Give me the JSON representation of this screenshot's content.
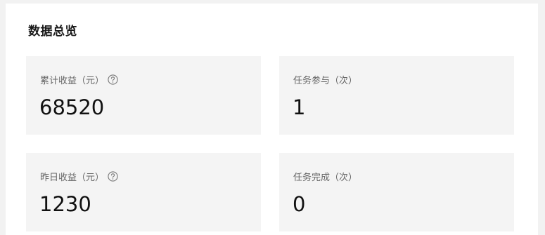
{
  "overview": {
    "title": "数据总览",
    "cards": [
      {
        "label": "累计收益（元）",
        "value": "68520",
        "has_help": true
      },
      {
        "label": "任务参与（次）",
        "value": "1",
        "has_help": false
      },
      {
        "label": "昨日收益（元）",
        "value": "1230",
        "has_help": true
      },
      {
        "label": "任务完成（次）",
        "value": "0",
        "has_help": false
      }
    ]
  },
  "icons": {
    "help": "question-circle-icon"
  },
  "colors": {
    "card_background": "#f4f4f4",
    "panel_background": "#ffffff",
    "page_background": "#f2f2f2",
    "label_text": "#666666",
    "value_text": "#111111"
  }
}
